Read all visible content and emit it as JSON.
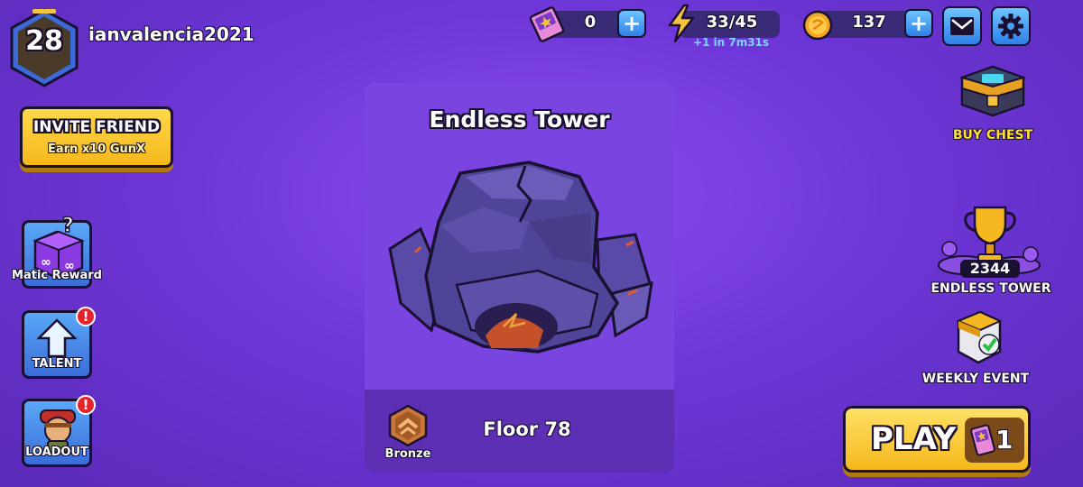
{
  "player": {
    "level": "28",
    "username": "ianvalencia2021"
  },
  "currencies": {
    "tickets": "0",
    "energy": "33/45",
    "energy_timer": "+1 in 7m31s",
    "coins": "137"
  },
  "invite": {
    "title": "INVITE FRIEND",
    "subtitle": "Earn x10 GunX"
  },
  "sidebar": {
    "matic_reward": "Matic Reward",
    "talent": "TALENT",
    "loadout": "LOADOUT",
    "alert_mark": "!"
  },
  "tower_card": {
    "title": "Endless Tower",
    "floor": "Floor 78",
    "rank": "Bronze"
  },
  "right_panel": {
    "buy_chest": "BUY CHEST",
    "endless_tower_score": "2344",
    "endless_tower_label": "ENDLESS TOWER",
    "weekly_event": "WEEKLY EVENT"
  },
  "play": {
    "label": "PLAY",
    "cost": "1"
  },
  "colors": {
    "background": "#6e36d8",
    "accent_yellow": "#f5b81c",
    "button_blue": "#2f80e8",
    "alert_red": "#e4232d",
    "buy_chest_text": "#ffe033"
  }
}
